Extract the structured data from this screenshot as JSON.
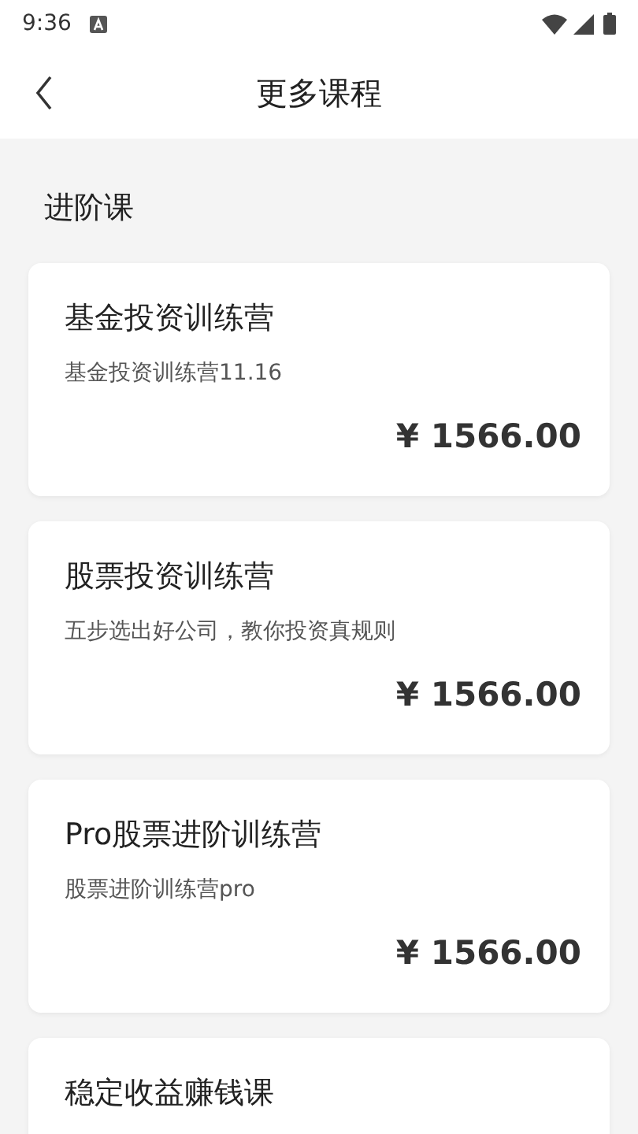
{
  "status_bar": {
    "time": "9:36"
  },
  "header": {
    "title": "更多课程"
  },
  "section": {
    "title": "进阶课"
  },
  "courses": [
    {
      "title": "基金投资训练营",
      "subtitle": "基金投资训练营11.16",
      "price": "¥ 1566.00"
    },
    {
      "title": "股票投资训练营",
      "subtitle": "五步选出好公司，教你投资真规则",
      "price": "¥ 1566.00"
    },
    {
      "title": "Pro股票进阶训练营",
      "subtitle": "股票进阶训练营pro",
      "price": "¥ 1566.00"
    },
    {
      "title": "稳定收益赚钱课"
    }
  ]
}
